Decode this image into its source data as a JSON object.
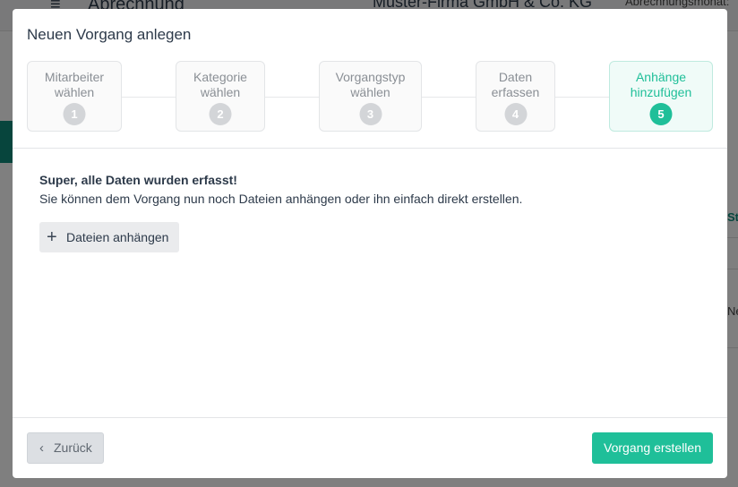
{
  "background": {
    "menu_icon": "hamburger-icon",
    "page_title": "Abrechnung",
    "company": "Muster-Firma GmbH & Co. KG",
    "month_label": "Abrechnungsmonat:",
    "col_header_partial": "St",
    "cell_partial": "Ne"
  },
  "modal": {
    "title": "Neuen Vorgang anlegen",
    "steps": [
      {
        "line1": "Mitarbeiter",
        "line2": "wählen",
        "number": "1"
      },
      {
        "line1": "Kategorie",
        "line2": "wählen",
        "number": "2"
      },
      {
        "line1": "Vorgangstyp",
        "line2": "wählen",
        "number": "3"
      },
      {
        "line1": "Daten",
        "line2": "erfassen",
        "number": "4"
      },
      {
        "line1": "Anhänge",
        "line2": "hinzufügen",
        "number": "5"
      }
    ],
    "active_step": 5,
    "message_bold": "Super, alle Daten wurden erfasst!",
    "message_text": "Sie können dem Vorgang nun noch Dateien anhängen oder ihn einfach direkt erstellen.",
    "attach_button": {
      "icon": "plus-icon",
      "label": "Dateien anhängen"
    },
    "back_button": {
      "icon": "chevron-left-icon",
      "label": "Zurück"
    },
    "create_button": {
      "label": "Vorgang erstellen"
    }
  },
  "colors": {
    "accent": "#1fbf99",
    "text": "#2d3a4a",
    "step_inactive": "#d3d5d8"
  }
}
